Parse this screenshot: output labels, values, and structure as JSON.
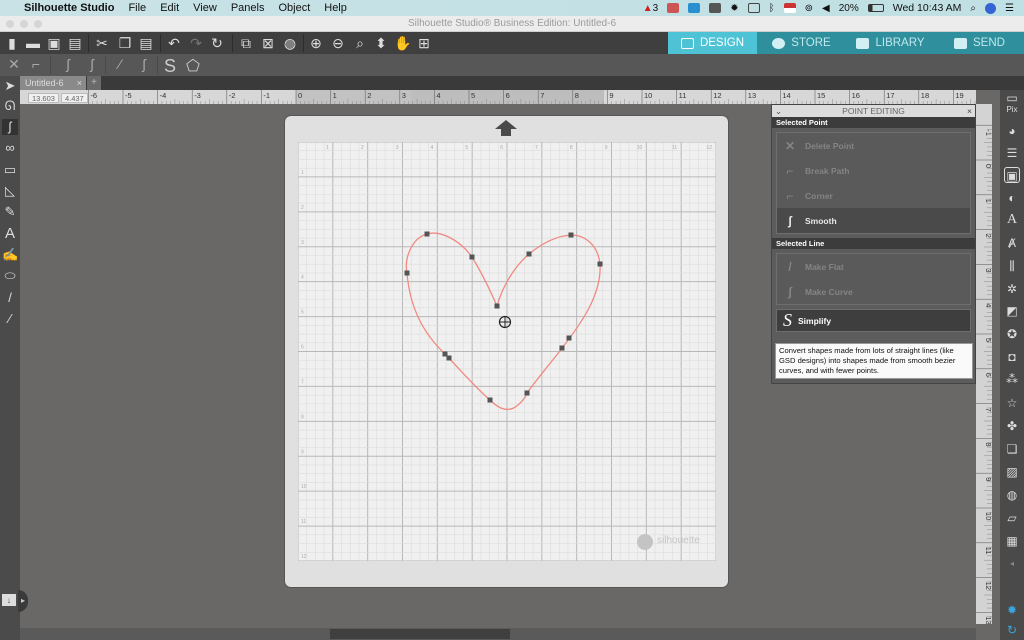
{
  "menubar": {
    "app": "Silhouette Studio",
    "items": [
      "File",
      "Edit",
      "View",
      "Panels",
      "Object",
      "Help"
    ],
    "tray": {
      "notification_count": "3",
      "battery": "20%",
      "clock": "Wed 10:43 AM"
    }
  },
  "window": {
    "title": "Silhouette Studio® Business Edition: Untitled-6"
  },
  "toolbar": {
    "icons": [
      "new-document-icon",
      "open-folder-icon",
      "save-icon",
      "print-icon",
      "cut-icon",
      "copy-icon",
      "paste-icon",
      "undo-icon",
      "redo-icon",
      "redraw-icon",
      "group-icon",
      "ungroup-icon",
      "compound-icon",
      "zoom-in-icon",
      "zoom-out-icon",
      "zoom-selection-icon",
      "move-down-icon",
      "pan-hand-icon",
      "fit-to-page-icon"
    ]
  },
  "nav": [
    {
      "label": "DESIGN",
      "active": true
    },
    {
      "label": "STORE"
    },
    {
      "label": "LIBRARY"
    },
    {
      "label": "SEND"
    }
  ],
  "tabs": {
    "doc": "Untitled-6",
    "close": "×",
    "add": "+"
  },
  "coords": {
    "x": "13.603",
    "y": "4.437"
  },
  "ruler": {
    "h_labels": [
      "-6",
      "-5",
      "-4",
      "-3",
      "-2",
      "-1",
      "0",
      "1",
      "2",
      "3",
      "4",
      "5",
      "6",
      "7",
      "8",
      "9",
      "10",
      "11",
      "12",
      "13",
      "14",
      "15",
      "16",
      "17",
      "18",
      "19"
    ],
    "v_labels": [
      "-1",
      "0",
      "1",
      "2",
      "3",
      "4",
      "5",
      "6",
      "7",
      "8",
      "9",
      "10",
      "11",
      "12",
      "13"
    ]
  },
  "mat": {
    "brand": "silhouette",
    "grid_top": [
      "1",
      "2",
      "3",
      "4",
      "5",
      "6",
      "7",
      "8",
      "9",
      "10",
      "11",
      "12"
    ],
    "grid_left": [
      "1",
      "2",
      "3",
      "4",
      "5",
      "6",
      "7",
      "8",
      "9",
      "10",
      "11",
      "12"
    ]
  },
  "panel": {
    "title": "POINT EDITING",
    "close": "×",
    "collapse": "⌄",
    "selected_point": "Selected Point",
    "point_items": [
      {
        "label": "Delete Point",
        "icon": "✕"
      },
      {
        "label": "Break Path",
        "icon": "⌐"
      },
      {
        "label": "Corner",
        "icon": "⌐"
      },
      {
        "label": "Smooth",
        "icon": "ʃ"
      }
    ],
    "selected_line": "Selected Line",
    "line_items": [
      {
        "label": "Make Flat",
        "icon": "/"
      },
      {
        "label": "Make Curve",
        "icon": "ʃ"
      }
    ],
    "simplify": "Simplify",
    "tooltip": "Convert shapes made from lots of straight lines (like GSD designs) into shapes made from smooth bezier curves, and with fewer points."
  },
  "colors": {
    "accent": "#4ec3d6",
    "nav_bg": "#2f8f9c",
    "path": "#f08a80"
  }
}
